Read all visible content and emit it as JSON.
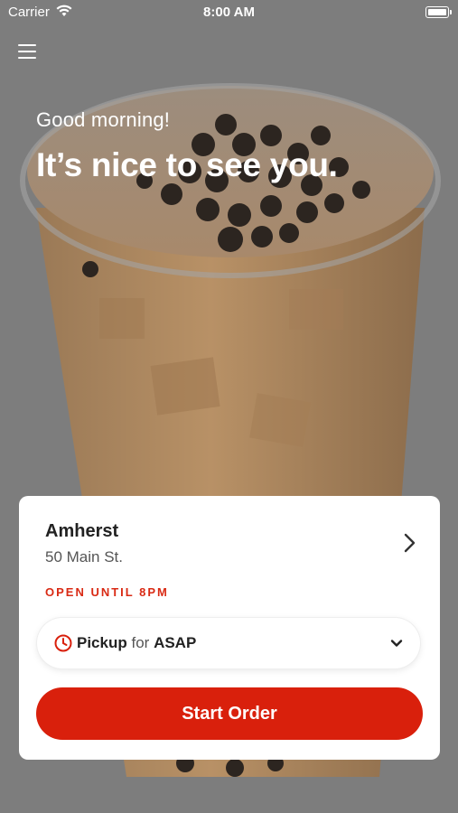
{
  "status_bar": {
    "carrier": "Carrier",
    "time": "8:00 AM"
  },
  "menu": {
    "icon": "hamburger-menu-icon"
  },
  "greeting": {
    "small": "Good morning!",
    "large": "It’s nice to see you."
  },
  "store": {
    "name": "Amherst",
    "address": "50 Main St.",
    "hours": "OPEN UNTIL 8PM"
  },
  "order_type": {
    "mode": "Pickup",
    "connector": "for",
    "time": "ASAP"
  },
  "start_order": {
    "label": "Start Order"
  },
  "colors": {
    "accent": "#d9200c",
    "hours_text": "#d92a14",
    "overlay": "#7d7d7d"
  }
}
